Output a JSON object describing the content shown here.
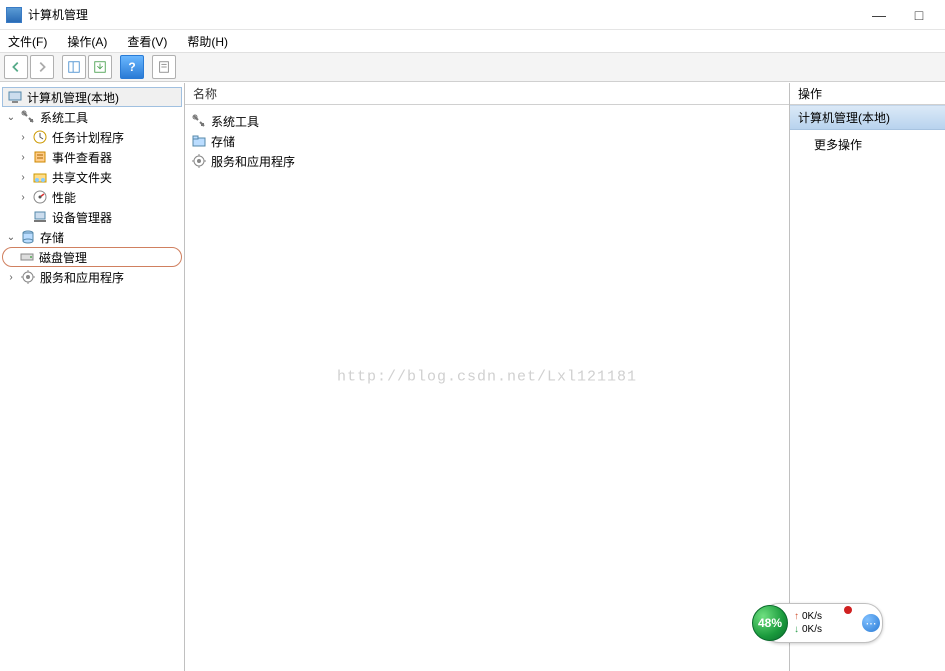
{
  "window": {
    "title": "计算机管理",
    "minimize": "—",
    "maximize": "□",
    "close": "×"
  },
  "menu": {
    "file": "文件(F)",
    "action": "操作(A)",
    "view": "查看(V)",
    "help": "帮助(H)"
  },
  "toolbar": {
    "back": "back",
    "forward": "forward",
    "show_hide": "show-hide-tree",
    "export": "export-list",
    "help": "?",
    "properties": "properties"
  },
  "tree": {
    "root": "计算机管理(本地)",
    "system_tools": "系统工具",
    "task_scheduler": "任务计划程序",
    "event_viewer": "事件查看器",
    "shared_folders": "共享文件夹",
    "performance": "性能",
    "device_manager": "设备管理器",
    "storage": "存储",
    "disk_management": "磁盘管理",
    "services_apps": "服务和应用程序"
  },
  "list": {
    "column_name": "名称",
    "items": {
      "system_tools": "系统工具",
      "storage": "存储",
      "services_apps": "服务和应用程序"
    }
  },
  "actions": {
    "header": "操作",
    "selected": "计算机管理(本地)",
    "more": "更多操作"
  },
  "watermark": "http://blog.csdn.net/Lxl121181",
  "widget": {
    "main_percent": "48%",
    "up_speed": "0K/s",
    "down_speed": "0K/s"
  }
}
